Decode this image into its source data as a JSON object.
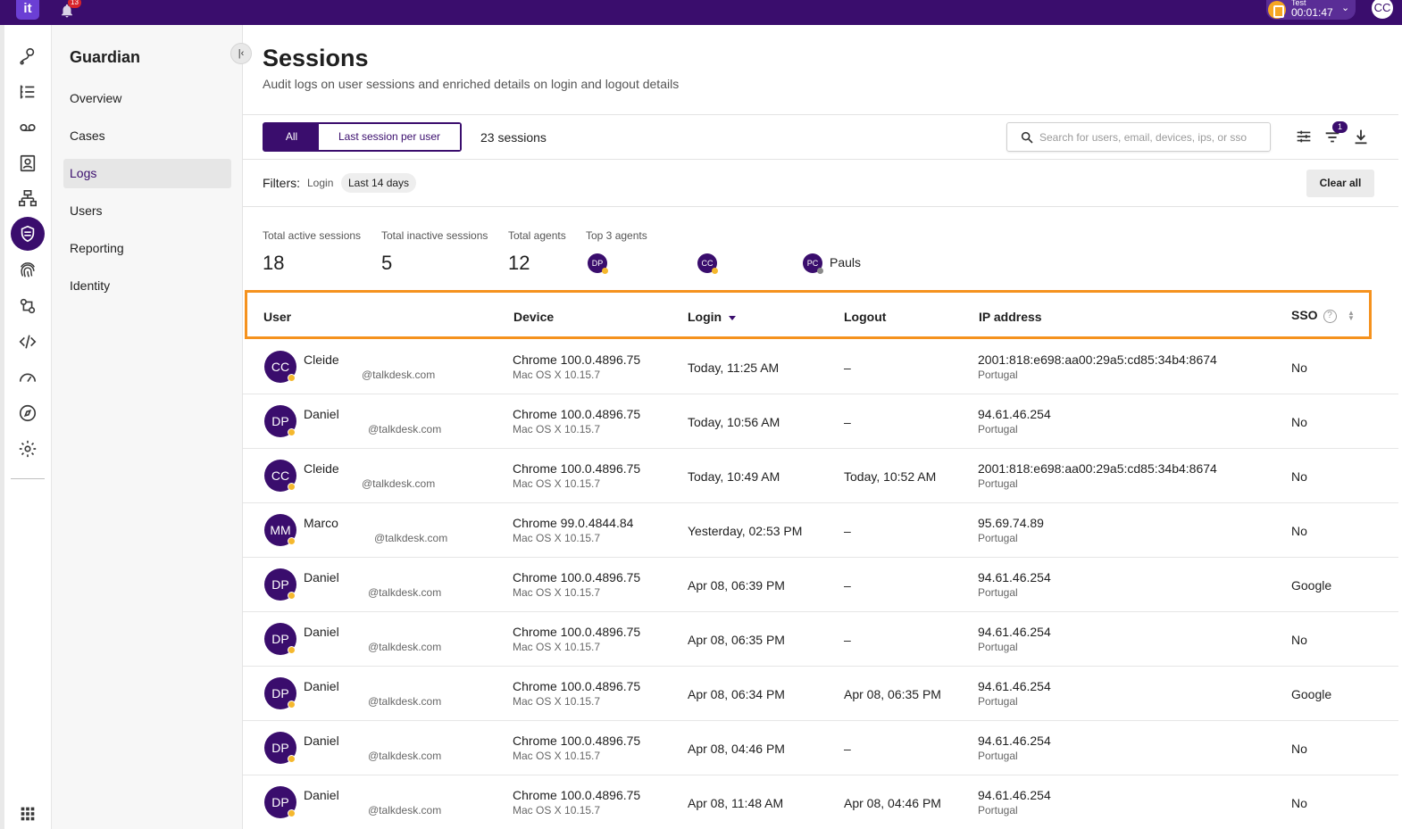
{
  "topbar": {
    "notification_count": "13",
    "timer_label": "Test",
    "timer_time": "00:01:47",
    "user_initials": "CC",
    "colors": {
      "bar": "#3a0d6d",
      "timer": "#f5a623",
      "badge": "#d8232a"
    }
  },
  "rail": {
    "icons": [
      "routing-icon",
      "list-icon",
      "voicemail-icon",
      "contacts-icon",
      "flow-icon",
      "guardian-shield-icon",
      "fingerprint-icon",
      "automation-icon",
      "code-icon",
      "dashboard-icon",
      "compass-icon",
      "gear-icon",
      "apps-grid-icon"
    ]
  },
  "subnav": {
    "title": "Guardian",
    "items": [
      {
        "label": "Overview",
        "active": false
      },
      {
        "label": "Cases",
        "active": false
      },
      {
        "label": "Logs",
        "active": true
      },
      {
        "label": "Users",
        "active": false
      },
      {
        "label": "Reporting",
        "active": false
      },
      {
        "label": "Identity",
        "active": false
      }
    ]
  },
  "header": {
    "title": "Sessions",
    "subtitle": "Audit logs on user sessions and enriched details on login and logout details"
  },
  "toolbar": {
    "seg_all": "All",
    "seg_last": "Last session per user",
    "count": "23 sessions",
    "search_placeholder": "Search for users, email, devices, ips, or sso",
    "filter_count": "1"
  },
  "filters": {
    "label": "Filters:",
    "field": "Login",
    "chip": "Last 14 days",
    "clear": "Clear all"
  },
  "stats": {
    "active_label": "Total active sessions",
    "active_value": "18",
    "inactive_label": "Total inactive sessions",
    "inactive_value": "5",
    "agents_label": "Total agents",
    "agents_value": "12",
    "top_label": "Top 3 agents",
    "top_agents": [
      {
        "initials": "DP",
        "name": ""
      },
      {
        "initials": "CC",
        "name": ""
      },
      {
        "initials": "PC",
        "name": "Pauls"
      }
    ]
  },
  "table": {
    "headers": {
      "user": "User",
      "device": "Device",
      "login": "Login",
      "logout": "Logout",
      "ip": "IP address",
      "sso": "SSO",
      "sso_help": "?"
    },
    "rows": [
      {
        "initials": "CC",
        "name": "Cleide",
        "email": "@talkdesk.com",
        "browser": "Chrome 100.0.4896.75",
        "os": "Mac OS X 10.15.7",
        "login": "Today, 11:25 AM",
        "logout": "–",
        "ip": "2001:818:e698:aa00:29a5:cd85:34b4:8674",
        "country": "Portugal",
        "sso": "No"
      },
      {
        "initials": "DP",
        "name": "Daniel",
        "email": "@talkdesk.com",
        "browser": "Chrome 100.0.4896.75",
        "os": "Mac OS X 10.15.7",
        "login": "Today, 10:56 AM",
        "logout": "–",
        "ip": "94.61.46.254",
        "country": "Portugal",
        "sso": "No"
      },
      {
        "initials": "CC",
        "name": "Cleide",
        "email": "@talkdesk.com",
        "browser": "Chrome 100.0.4896.75",
        "os": "Mac OS X 10.15.7",
        "login": "Today, 10:49 AM",
        "logout": "Today, 10:52 AM",
        "ip": "2001:818:e698:aa00:29a5:cd85:34b4:8674",
        "country": "Portugal",
        "sso": "No"
      },
      {
        "initials": "MM",
        "name": "Marco",
        "email": "@talkdesk.com",
        "browser": "Chrome 99.0.4844.84",
        "os": "Mac OS X 10.15.7",
        "login": "Yesterday, 02:53 PM",
        "logout": "–",
        "ip": "95.69.74.89",
        "country": "Portugal",
        "sso": "No"
      },
      {
        "initials": "DP",
        "name": "Daniel",
        "email": "@talkdesk.com",
        "browser": "Chrome 100.0.4896.75",
        "os": "Mac OS X 10.15.7",
        "login": "Apr 08, 06:39 PM",
        "logout": "–",
        "ip": "94.61.46.254",
        "country": "Portugal",
        "sso": "Google"
      },
      {
        "initials": "DP",
        "name": "Daniel",
        "email": "@talkdesk.com",
        "browser": "Chrome 100.0.4896.75",
        "os": "Mac OS X 10.15.7",
        "login": "Apr 08, 06:35 PM",
        "logout": "–",
        "ip": "94.61.46.254",
        "country": "Portugal",
        "sso": "No"
      },
      {
        "initials": "DP",
        "name": "Daniel",
        "email": "@talkdesk.com",
        "browser": "Chrome 100.0.4896.75",
        "os": "Mac OS X 10.15.7",
        "login": "Apr 08, 06:34 PM",
        "logout": "Apr 08, 06:35 PM",
        "ip": "94.61.46.254",
        "country": "Portugal",
        "sso": "Google"
      },
      {
        "initials": "DP",
        "name": "Daniel",
        "email": "@talkdesk.com",
        "browser": "Chrome 100.0.4896.75",
        "os": "Mac OS X 10.15.7",
        "login": "Apr 08, 04:46 PM",
        "logout": "–",
        "ip": "94.61.46.254",
        "country": "Portugal",
        "sso": "No"
      },
      {
        "initials": "DP",
        "name": "Daniel",
        "email": "@talkdesk.com",
        "browser": "Chrome 100.0.4896.75",
        "os": "Mac OS X 10.15.7",
        "login": "Apr 08, 11:48 AM",
        "logout": "Apr 08, 04:46 PM",
        "ip": "94.61.46.254",
        "country": "Portugal",
        "sso": "No"
      }
    ],
    "status_color": "#f5b82e",
    "highlight_color": "#f5921e"
  }
}
